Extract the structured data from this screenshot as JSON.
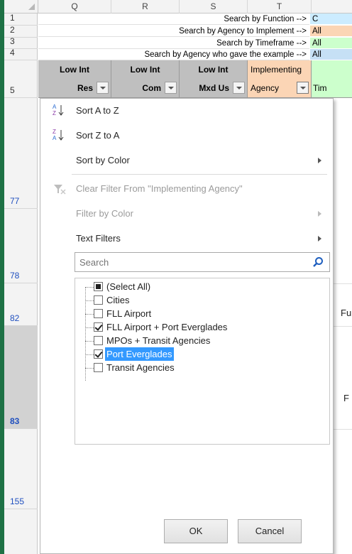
{
  "columns": [
    "Q",
    "R",
    "S",
    "T"
  ],
  "rows": {
    "search": [
      "1",
      "2",
      "3",
      "4"
    ],
    "header": "5",
    "data": [
      "77",
      "78",
      "82",
      "83",
      "155"
    ]
  },
  "search_rows": [
    {
      "label": "Search by Function -->",
      "value": "C",
      "color": "#ccecff"
    },
    {
      "label": "Search by Agency to Implement -->",
      "value": "All",
      "color": "#fbd5b5"
    },
    {
      "label": "Search by Timeframe -->",
      "value": "All",
      "color": "#ccffcc"
    },
    {
      "label": "Search by Agency who gave the example -->",
      "value": "All",
      "color": "#c6e0f5"
    }
  ],
  "header_cells": [
    {
      "line1": "Low Int",
      "line2": "Res"
    },
    {
      "line1": "Low Int",
      "line2": "Com"
    },
    {
      "line1": "Low Int",
      "line2": "Mxd Us"
    },
    {
      "line1": "Implementing",
      "line2": "Agency"
    }
  ],
  "header_partial": "Tim",
  "colors": {
    "header_gray": "#bfbfbf",
    "header_orange": "#fbd5b5",
    "header_green": "#ccffcc",
    "highlight": "#3399ff",
    "excel_green": "#1e7145"
  },
  "menu": {
    "sort_az": "Sort A to Z",
    "sort_za": "Sort Z to A",
    "sort_by_color": "Sort by Color",
    "clear_filter": "Clear Filter From \"Implementing Agency\"",
    "filter_by_color": "Filter by Color",
    "text_filters": "Text Filters",
    "search_placeholder": "Search",
    "items": [
      {
        "label": "(Select All)",
        "state": "partial"
      },
      {
        "label": "Cities",
        "state": "unchecked"
      },
      {
        "label": "FLL Airport",
        "state": "unchecked"
      },
      {
        "label": "FLL Airport + Port Everglades",
        "state": "checked"
      },
      {
        "label": "MPOs + Transit Agencies",
        "state": "unchecked"
      },
      {
        "label": "Port Everglades",
        "state": "checked"
      },
      {
        "label": "Transit Agencies",
        "state": "unchecked"
      }
    ],
    "ok": "OK",
    "cancel": "Cancel"
  },
  "right_cells": {
    "row82": "Fu",
    "row83": "F"
  }
}
